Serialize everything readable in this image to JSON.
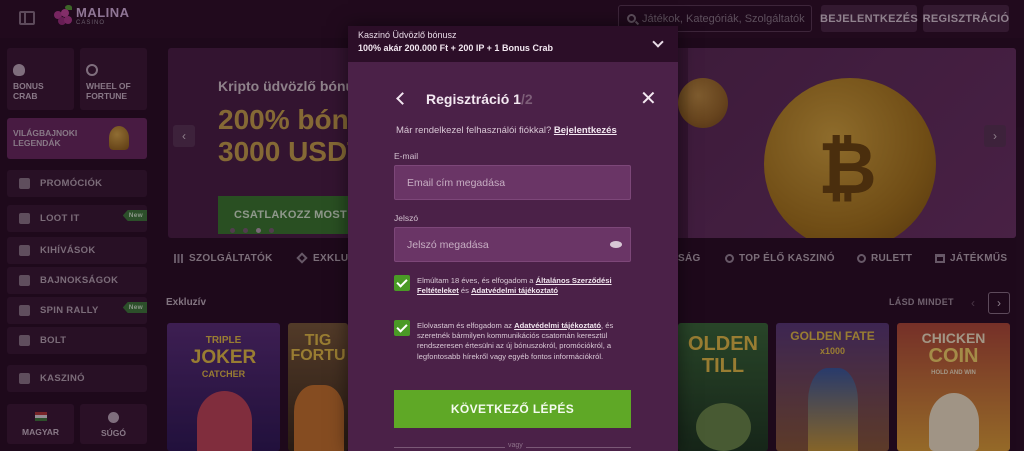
{
  "header": {
    "logo_name": "MALINA",
    "logo_sub": "CASINO",
    "search_placeholder": "Játékok, Kategóriák, Szolgáltatók",
    "login_label": "BEJELENTKEZÉS",
    "register_label": "REGISZTRÁCIÓ"
  },
  "sidebar": {
    "tiles": [
      {
        "line1": "BONUS",
        "line2": "CRAB",
        "icon": "crab-icon"
      },
      {
        "line1": "WHEEL OF",
        "line2": "FORTUNE",
        "icon": "wheel-icon"
      },
      {
        "line1": "VILÁGBAJNOKI",
        "line2": "LEGENDÁK",
        "icon": "trophy-icon"
      }
    ],
    "items": [
      {
        "label": "PROMÓCIÓK",
        "icon": "gift-icon"
      },
      {
        "label": "LOOT IT",
        "icon": "loot-icon",
        "badge": "New"
      },
      {
        "label": "KIHÍVÁSOK",
        "icon": "challenge-icon"
      },
      {
        "label": "BAJNOKSÁGOK",
        "icon": "trophy-icon"
      },
      {
        "label": "SPIN RALLY",
        "icon": "rally-icon",
        "badge": "New"
      },
      {
        "label": "BOLT",
        "icon": "shop-icon"
      },
      {
        "label": "KASZINÓ",
        "icon": "casino-icon"
      }
    ],
    "language_label": "MAGYAR",
    "help_label": "SÚGÓ"
  },
  "banner": {
    "title": "Kripto üdvözlő bónu",
    "big_line1": "200% bón",
    "big_line2": "3000 USDT",
    "cta": "CSATLAKOZZ MOST"
  },
  "categories": [
    {
      "label": "SZOLGÁLTATÓK"
    },
    {
      "label": "EXKLU"
    },
    {
      "label": "SÁG"
    },
    {
      "label": "TOP ÉLŐ KASZINÓ"
    },
    {
      "label": "RULETT"
    },
    {
      "label": "JÁTÉKMŰS"
    }
  ],
  "section": {
    "title": "Exkluzív",
    "see_all": "LÁSD MINDET"
  },
  "games": [
    {
      "name_line1": "TRIPLE",
      "name_line2": "JOKER",
      "name_line3": "CATCHER"
    },
    {
      "name_line1": "TIG",
      "name_line2": "FORTU",
      "name_line3": ""
    },
    {
      "name_line1": "OLDEN",
      "name_line2": "TILL",
      "name_line3": ""
    },
    {
      "name_line1": "GOLDEN FATE",
      "name_line2": "x1000",
      "name_line3": ""
    },
    {
      "name_line1": "CHICKEN",
      "name_line2": "COIN",
      "name_line3": "HOLD AND WIN"
    }
  ],
  "modal": {
    "bonus_line1": "Kaszinó Üdvözlő bónusz",
    "bonus_line2": "100% akár 200.000 Ft + 200 IP + 1 Bonus Crab",
    "title": "Regisztráció 1",
    "title_step": "/2",
    "login_prompt": "Már rendelkezel felhasználói fiókkal?",
    "login_link": "Bejelentkezés",
    "email_label": "E-mail",
    "email_placeholder": "Email cím megadása",
    "password_label": "Jelszó",
    "password_placeholder": "Jelszó megadása",
    "consent1_text": "Elmúltam 18 éves, és elfogadom a",
    "consent1_link1": "Általános Szerződési Feltételeket",
    "consent1_mid": "és",
    "consent1_link2": "Adatvédelmi tájékoztató",
    "consent2_text": "Elolvastam és elfogadom az",
    "consent2_link": "Adatvédelmi tájékoztató",
    "consent2_rest": ", és szeretnék bármilyen kommunikációs csatornán keresztül rendszeresen értesülni az új bónuszokról, promóciókról, a legfontosabb hírekről vagy egyéb fontos információkról.",
    "next_label": "KÖVETKEZŐ LÉPÉS",
    "or_label": "vagy"
  },
  "colors": {
    "accent_green": "#5fa826",
    "modal_bg": "#4b2148",
    "gold": "#c8a24e"
  }
}
